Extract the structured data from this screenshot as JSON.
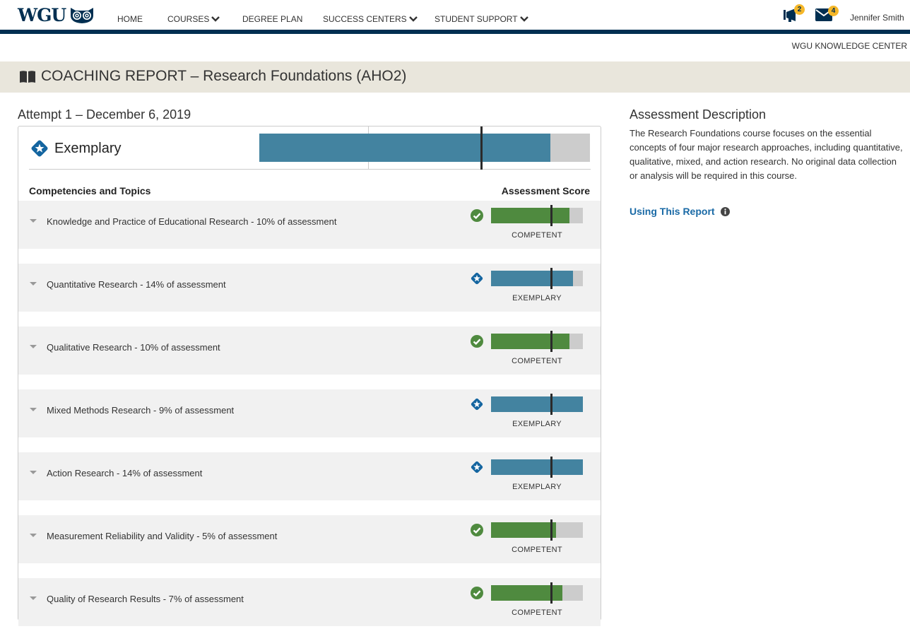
{
  "nav": {
    "logo_text": "WGU",
    "items": [
      {
        "label": "HOME",
        "dropdown": false
      },
      {
        "label": "COURSES",
        "dropdown": true
      },
      {
        "label": "DEGREE PLAN",
        "dropdown": false
      },
      {
        "label": "SUCCESS CENTERS",
        "dropdown": true
      },
      {
        "label": "STUDENT SUPPORT",
        "dropdown": true
      }
    ],
    "announcements_badge": "2",
    "messages_badge": "4",
    "user_name": "Jennifer Smith",
    "knowledge_center": "WGU KNOWLEDGE CENTER"
  },
  "colors": {
    "navy": "#002f51",
    "exemplary": "#4383a0",
    "competent": "#4f8a3f",
    "track": "#cccccc",
    "link": "#1a6aa6",
    "badge": "#f5b729",
    "band": "#e9e6dc"
  },
  "page": {
    "title": "COACHING REPORT – Research Foundations (AHO2)",
    "attempt": "Attempt 1 – December 6, 2019"
  },
  "overall": {
    "level": "Exemplary",
    "score_fraction": 0.88,
    "marker_fraction": 0.67,
    "gridline_fractions": [
      0.33,
      0.67
    ]
  },
  "table": {
    "col_left": "Competencies and Topics",
    "col_right": "Assessment Score",
    "rows": [
      {
        "label": "Knowledge and Practice of Educational Research - 10% of assessment",
        "status": "COMPETENT",
        "level": "competent",
        "score_fraction": 0.85,
        "marker_fraction": 0.65
      },
      {
        "label": "Quantitative Research - 14% of assessment",
        "status": "EXEMPLARY",
        "level": "exemplary",
        "score_fraction": 0.89,
        "marker_fraction": 0.65
      },
      {
        "label": "Qualitative Research - 10% of assessment",
        "status": "COMPETENT",
        "level": "competent",
        "score_fraction": 0.85,
        "marker_fraction": 0.65
      },
      {
        "label": "Mixed Methods Research - 9% of assessment",
        "status": "EXEMPLARY",
        "level": "exemplary",
        "score_fraction": 1.0,
        "marker_fraction": 0.65
      },
      {
        "label": "Action Research - 14% of assessment",
        "status": "EXEMPLARY",
        "level": "exemplary",
        "score_fraction": 1.0,
        "marker_fraction": 0.65
      },
      {
        "label": "Measurement Reliability and Validity - 5% of assessment",
        "status": "COMPETENT",
        "level": "competent",
        "score_fraction": 0.71,
        "marker_fraction": 0.65
      },
      {
        "label": "Quality of Research Results - 7% of assessment",
        "status": "COMPETENT",
        "level": "competent",
        "score_fraction": 0.78,
        "marker_fraction": 0.65
      }
    ]
  },
  "sidebar": {
    "title": "Assessment Description",
    "description": "The Research Foundations course focuses on the essential concepts of four major research approaches, including quantitative, qualitative, mixed, and action research. No original data collection or analysis will be required in this course.",
    "using_link": "Using This Report"
  }
}
